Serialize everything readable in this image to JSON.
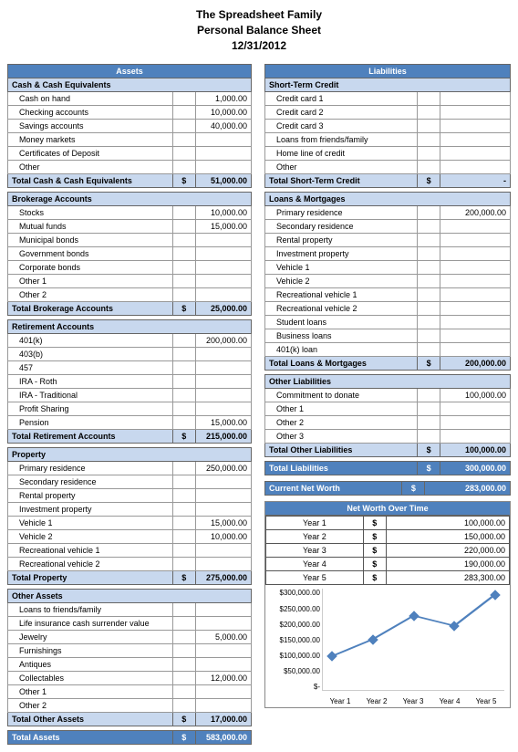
{
  "title": {
    "name": "The Spreadsheet Family",
    "sheet": "Personal Balance Sheet",
    "date": "12/31/2012"
  },
  "assets": {
    "header": "Assets",
    "sections": [
      {
        "title": "Cash & Cash Equivalents",
        "rows": [
          {
            "label": "Cash on hand",
            "value": "1,000.00"
          },
          {
            "label": "Checking accounts",
            "value": "10,000.00"
          },
          {
            "label": "Savings accounts",
            "value": "40,000.00"
          },
          {
            "label": "Money markets",
            "value": ""
          },
          {
            "label": "Certificates of Deposit",
            "value": ""
          },
          {
            "label": "Other",
            "value": ""
          }
        ],
        "total_label": "Total Cash & Cash Equivalents",
        "total_cur": "$",
        "total_value": "51,000.00"
      },
      {
        "title": "Brokerage Accounts",
        "rows": [
          {
            "label": "Stocks",
            "value": "10,000.00"
          },
          {
            "label": "Mutual funds",
            "value": "15,000.00"
          },
          {
            "label": "Municipal bonds",
            "value": ""
          },
          {
            "label": "Government bonds",
            "value": ""
          },
          {
            "label": "Corporate bonds",
            "value": ""
          },
          {
            "label": "Other 1",
            "value": ""
          },
          {
            "label": "Other 2",
            "value": ""
          }
        ],
        "total_label": "Total Brokerage Accounts",
        "total_cur": "$",
        "total_value": "25,000.00"
      },
      {
        "title": "Retirement Accounts",
        "rows": [
          {
            "label": "401(k)",
            "value": "200,000.00"
          },
          {
            "label": "403(b)",
            "value": ""
          },
          {
            "label": "457",
            "value": ""
          },
          {
            "label": "IRA - Roth",
            "value": ""
          },
          {
            "label": "IRA - Traditional",
            "value": ""
          },
          {
            "label": "Profit Sharing",
            "value": ""
          },
          {
            "label": "Pension",
            "value": "15,000.00"
          }
        ],
        "total_label": "Total Retirement Accounts",
        "total_cur": "$",
        "total_value": "215,000.00"
      },
      {
        "title": "Property",
        "rows": [
          {
            "label": "Primary residence",
            "value": "250,000.00"
          },
          {
            "label": "Secondary residence",
            "value": ""
          },
          {
            "label": "Rental property",
            "value": ""
          },
          {
            "label": "Investment property",
            "value": ""
          },
          {
            "label": "Vehicle 1",
            "value": "15,000.00"
          },
          {
            "label": "Vehicle 2",
            "value": "10,000.00"
          },
          {
            "label": "Recreational vehicle 1",
            "value": ""
          },
          {
            "label": "Recreational vehicle 2",
            "value": ""
          }
        ],
        "total_label": "Total Property",
        "total_cur": "$",
        "total_value": "275,000.00"
      },
      {
        "title": "Other Assets",
        "rows": [
          {
            "label": "Loans to friends/family",
            "value": ""
          },
          {
            "label": "Life insurance cash surrender value",
            "value": ""
          },
          {
            "label": "Jewelry",
            "value": "5,000.00"
          },
          {
            "label": "Furnishings",
            "value": ""
          },
          {
            "label": "Antiques",
            "value": ""
          },
          {
            "label": "Collectables",
            "value": "12,000.00"
          },
          {
            "label": "Other 1",
            "value": ""
          },
          {
            "label": "Other 2",
            "value": ""
          }
        ],
        "total_label": "Total Other Assets",
        "total_cur": "$",
        "total_value": "17,000.00"
      }
    ],
    "grand_label": "Total Assets",
    "grand_cur": "$",
    "grand_value": "583,000.00"
  },
  "liabilities": {
    "header": "Liabilities",
    "sections": [
      {
        "title": "Short-Term Credit",
        "rows": [
          {
            "label": "Credit card 1",
            "value": ""
          },
          {
            "label": "Credit card 2",
            "value": ""
          },
          {
            "label": "Credit card 3",
            "value": ""
          },
          {
            "label": "Loans from friends/family",
            "value": ""
          },
          {
            "label": "Home line of credit",
            "value": ""
          },
          {
            "label": "Other",
            "value": ""
          }
        ],
        "total_label": "Total Short-Term Credit",
        "total_cur": "$",
        "total_value": "-"
      },
      {
        "title": "Loans & Mortgages",
        "rows": [
          {
            "label": "Primary residence",
            "value": "200,000.00"
          },
          {
            "label": "Secondary residence",
            "value": ""
          },
          {
            "label": "Rental property",
            "value": ""
          },
          {
            "label": "Investment property",
            "value": ""
          },
          {
            "label": "Vehicle 1",
            "value": ""
          },
          {
            "label": "Vehicle 2",
            "value": ""
          },
          {
            "label": "Recreational vehicle 1",
            "value": ""
          },
          {
            "label": "Recreational vehicle 2",
            "value": ""
          },
          {
            "label": "Student loans",
            "value": ""
          },
          {
            "label": "Business loans",
            "value": ""
          },
          {
            "label": "401(k) loan",
            "value": ""
          }
        ],
        "total_label": "Total Loans & Mortgages",
        "total_cur": "$",
        "total_value": "200,000.00"
      },
      {
        "title": "Other Liabilities",
        "rows": [
          {
            "label": "Commitment to donate",
            "value": "100,000.00"
          },
          {
            "label": "Other 1",
            "value": ""
          },
          {
            "label": "Other 2",
            "value": ""
          },
          {
            "label": "Other 3",
            "value": ""
          }
        ],
        "total_label": "Total Other Liabilities",
        "total_cur": "$",
        "total_value": "100,000.00"
      }
    ],
    "grand_label": "Total Liabilities",
    "grand_cur": "$",
    "grand_value": "300,000.00"
  },
  "net_worth": {
    "label": "Current Net Worth",
    "cur": "$",
    "value": "283,000.00"
  },
  "chart_data": {
    "type": "line",
    "title": "Net Worth Over Time",
    "categories": [
      "Year 1",
      "Year 2",
      "Year 3",
      "Year 4",
      "Year 5"
    ],
    "series": [
      {
        "name": "Net Worth",
        "values": [
          100000,
          150000,
          220000,
          190000,
          283000
        ]
      }
    ],
    "table": [
      {
        "label": "Year 1",
        "cur": "$",
        "value": "100,000.00"
      },
      {
        "label": "Year 2",
        "cur": "$",
        "value": "150,000.00"
      },
      {
        "label": "Year 3",
        "cur": "$",
        "value": "220,000.00"
      },
      {
        "label": "Year 4",
        "cur": "$",
        "value": "190,000.00"
      },
      {
        "label": "Year 5",
        "cur": "$",
        "value": "283,300.00"
      }
    ],
    "y_ticks": [
      "$300,000.00",
      "$250,000.00",
      "$200,000.00",
      "$150,000.00",
      "$100,000.00",
      "$50,000.00",
      "$-"
    ],
    "ylim": [
      0,
      300000
    ]
  }
}
